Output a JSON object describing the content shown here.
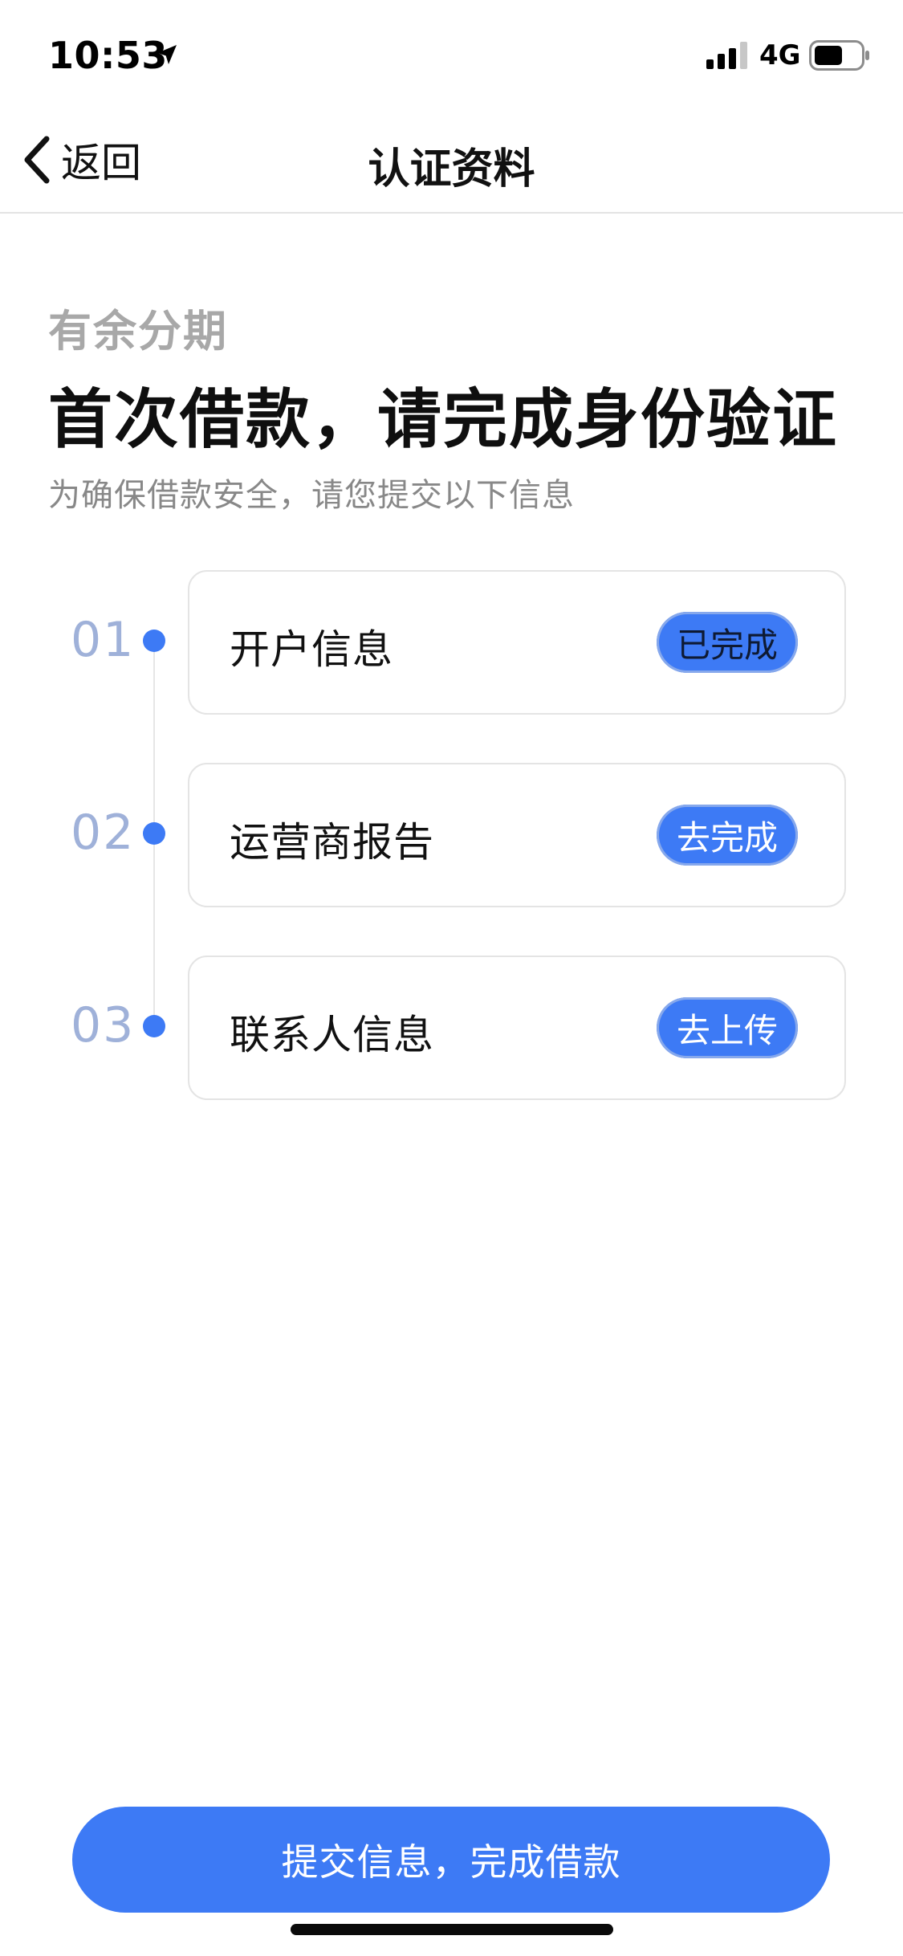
{
  "status_bar": {
    "time": "10:53",
    "network": "4G",
    "icons": [
      "location-arrow-icon",
      "signal-icon",
      "battery-icon"
    ]
  },
  "nav": {
    "back_label": "返回",
    "title": "认证资料",
    "back_icon": "chevron-left-icon"
  },
  "intro": {
    "brand": "有余分期",
    "headline": "首次借款，请完成身份验证",
    "subtitle": "为确保借款安全，请您提交以下信息"
  },
  "steps": [
    {
      "number": "01",
      "title": "开户信息",
      "action": "已完成",
      "status": "done"
    },
    {
      "number": "02",
      "title": "运营商报告",
      "action": "去完成",
      "status": "todo"
    },
    {
      "number": "03",
      "title": "联系人信息",
      "action": "去上传",
      "status": "todo"
    }
  ],
  "submit_label": "提交信息，完成借款",
  "colors": {
    "accent": "#3d7af5",
    "step_number": "#9fb1d9",
    "muted_text": "#888888",
    "brand_text": "#a8a8a8"
  }
}
